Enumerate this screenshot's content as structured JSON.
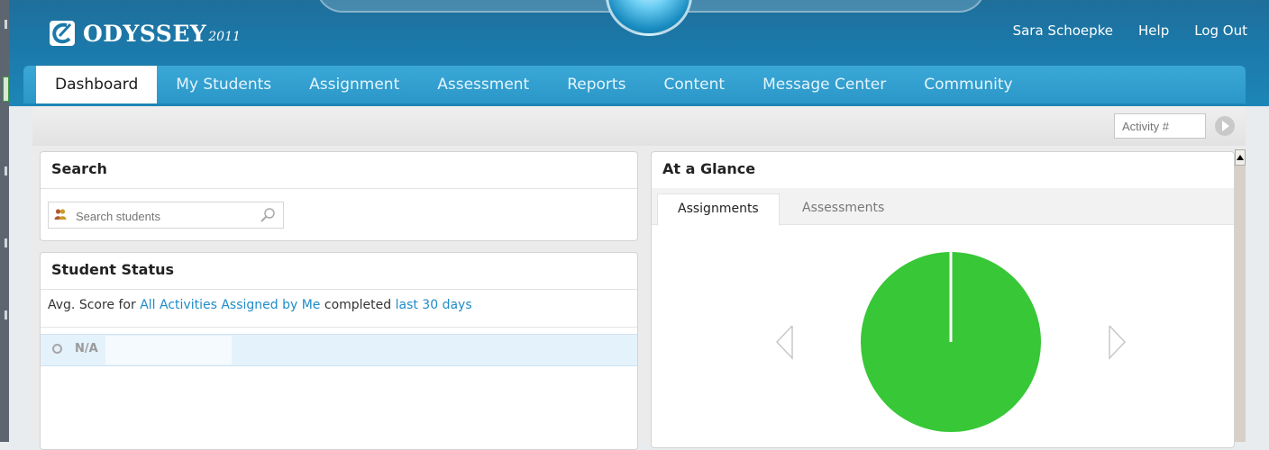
{
  "header": {
    "logo_text": "ODYSSEY",
    "logo_year": "2011",
    "user_name": "Sara Schoepke",
    "help_label": "Help",
    "logout_label": "Log Out"
  },
  "nav": {
    "tabs": [
      {
        "label": "Dashboard"
      },
      {
        "label": "My Students"
      },
      {
        "label": "Assignment"
      },
      {
        "label": "Assessment"
      },
      {
        "label": "Reports"
      },
      {
        "label": "Content"
      },
      {
        "label": "Message Center"
      },
      {
        "label": "Community"
      }
    ],
    "active_tab": "Dashboard"
  },
  "toolbar": {
    "activity_placeholder": "Activity #"
  },
  "search_panel": {
    "title": "Search",
    "placeholder": "Search students"
  },
  "status_panel": {
    "title": "Student Status",
    "avg_prefix": "Avg. Score for",
    "scope_link": "All Activities Assigned by Me",
    "avg_middle": "completed",
    "period_link": "last 30 days",
    "row_value": "N/A"
  },
  "glance_panel": {
    "title": "At a Glance",
    "tabs": [
      "Assignments",
      "Assessments"
    ],
    "active_tab": "Assignments"
  },
  "colors": {
    "header_blue": "#1b79aa",
    "tab_blue": "#2b97c8",
    "link_blue": "#1f8cc8",
    "pie_green": "#38c737"
  },
  "chart_data": {
    "type": "pie",
    "slices": [
      {
        "value": 100,
        "color": "#38c737"
      }
    ]
  }
}
